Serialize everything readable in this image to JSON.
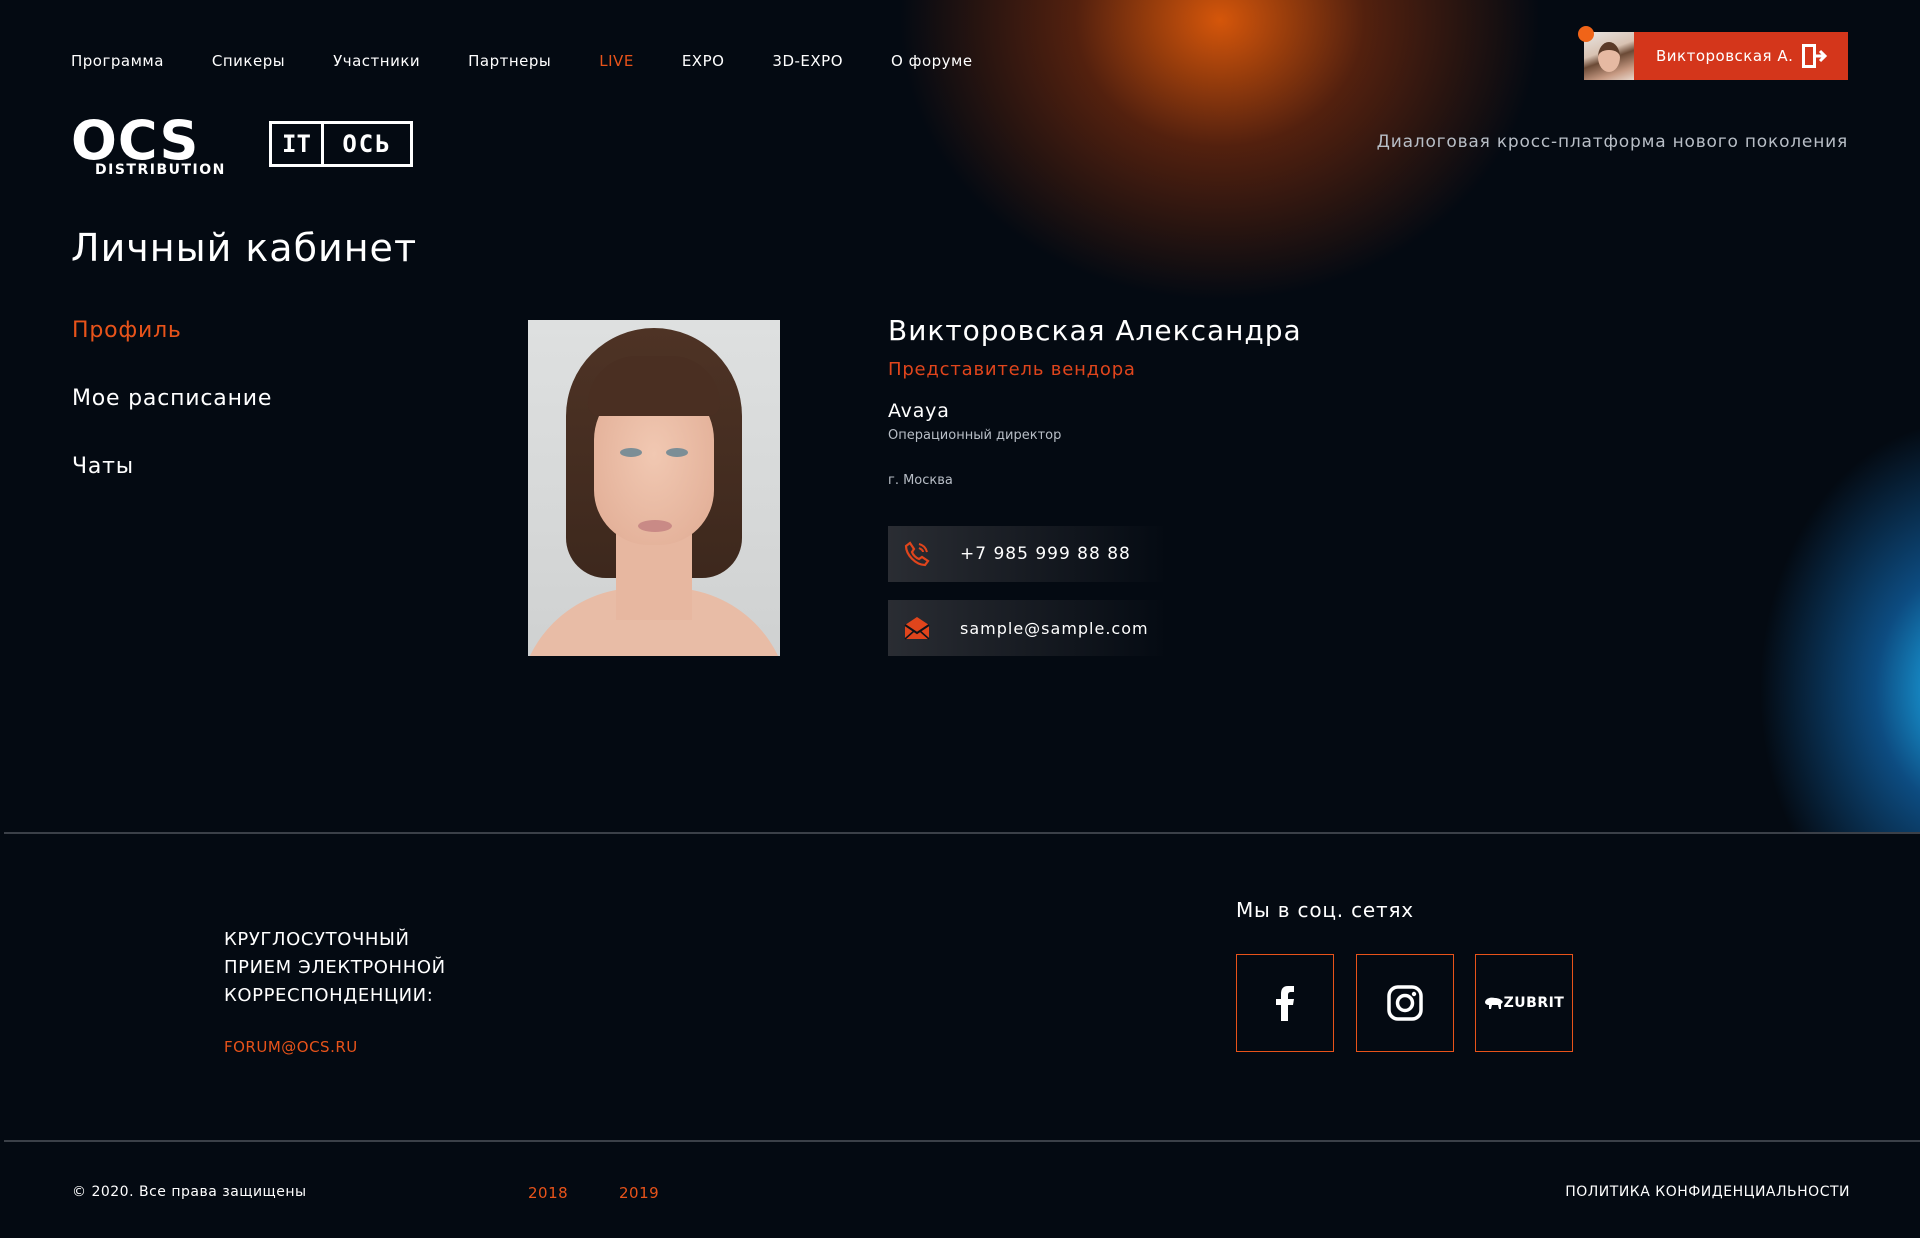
{
  "nav": {
    "items": [
      {
        "label": "Программа"
      },
      {
        "label": "Спикеры"
      },
      {
        "label": "Участники"
      },
      {
        "label": "Партнеры"
      },
      {
        "label": "LIVE",
        "active": true
      },
      {
        "label": "EXPO"
      },
      {
        "label": "3D-EXPO"
      },
      {
        "label": "О форуме"
      }
    ]
  },
  "user": {
    "name": "Викторовская А.",
    "logout_icon": "logout-icon"
  },
  "logos": {
    "ocs_main": "OCS",
    "ocs_sub": "DISTRIBUTION",
    "it_left": "IT",
    "it_right": "ОСЬ"
  },
  "tagline": "Диалоговая кросс-платформа нового поколения",
  "page_title": "Личный кабинет",
  "side_menu": [
    {
      "label": "Профиль",
      "active": true
    },
    {
      "label": "Мое расписание"
    },
    {
      "label": "Чаты"
    }
  ],
  "profile": {
    "name": "Викторовская Александра",
    "role": "Представитель вендора",
    "company": "Avaya",
    "position": "Операционный директор",
    "city": "г. Москва",
    "phone": "+7 985 999 88 88",
    "email": "sample@sample.com"
  },
  "footer": {
    "mail_title_lines": [
      "КРУГЛОСУТОЧНЫЙ",
      "ПРИЕМ ЭЛЕКТРОННОЙ",
      "КОРРЕСПОНДЕНЦИИ:"
    ],
    "mail_link": "FORUM@OCS.RU",
    "social_title": "Мы в соц. сетях",
    "social": [
      {
        "icon": "facebook-icon"
      },
      {
        "icon": "instagram-icon"
      },
      {
        "icon": "zubrit-icon",
        "label": "ZUBRIT"
      }
    ],
    "copyright": "© 2020. Все права защищены",
    "years": [
      "2018",
      "2019"
    ],
    "policy": "ПОЛИТИКА КОНФИДЕНЦИАЛЬНОСТИ"
  },
  "colors": {
    "accent": "#e8531a",
    "chip": "#d4361b",
    "background": "#040a12"
  }
}
